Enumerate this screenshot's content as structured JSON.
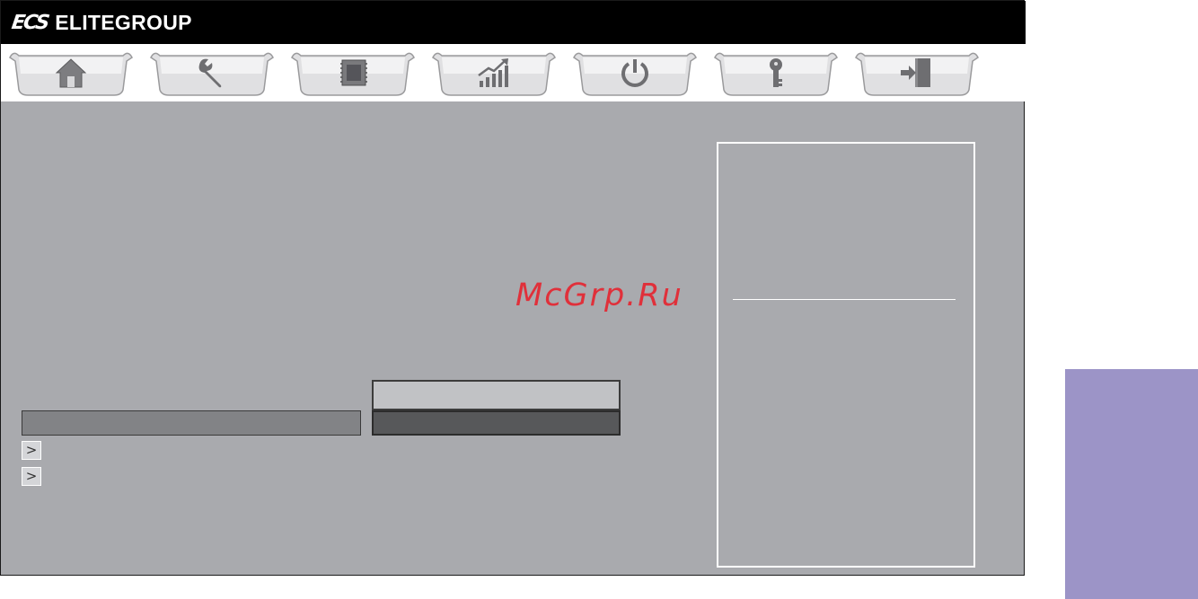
{
  "header": {
    "logo_mark": "ECS",
    "brand": "ELITEGROUP"
  },
  "tabs": [
    {
      "icon": "home-icon"
    },
    {
      "icon": "wrench-icon"
    },
    {
      "icon": "cpu-chip-icon"
    },
    {
      "icon": "performance-chart-icon"
    },
    {
      "icon": "power-icon"
    },
    {
      "icon": "key-icon"
    },
    {
      "icon": "exit-door-icon"
    }
  ],
  "submenu_items": [
    {
      "arrow": ">"
    },
    {
      "arrow": ">"
    }
  ],
  "watermark": "McGrp.Ru",
  "colors": {
    "background": "#a9aaae",
    "title_bar": "#000000",
    "side_tab": "#9c94c7",
    "watermark": "#e0303a"
  }
}
